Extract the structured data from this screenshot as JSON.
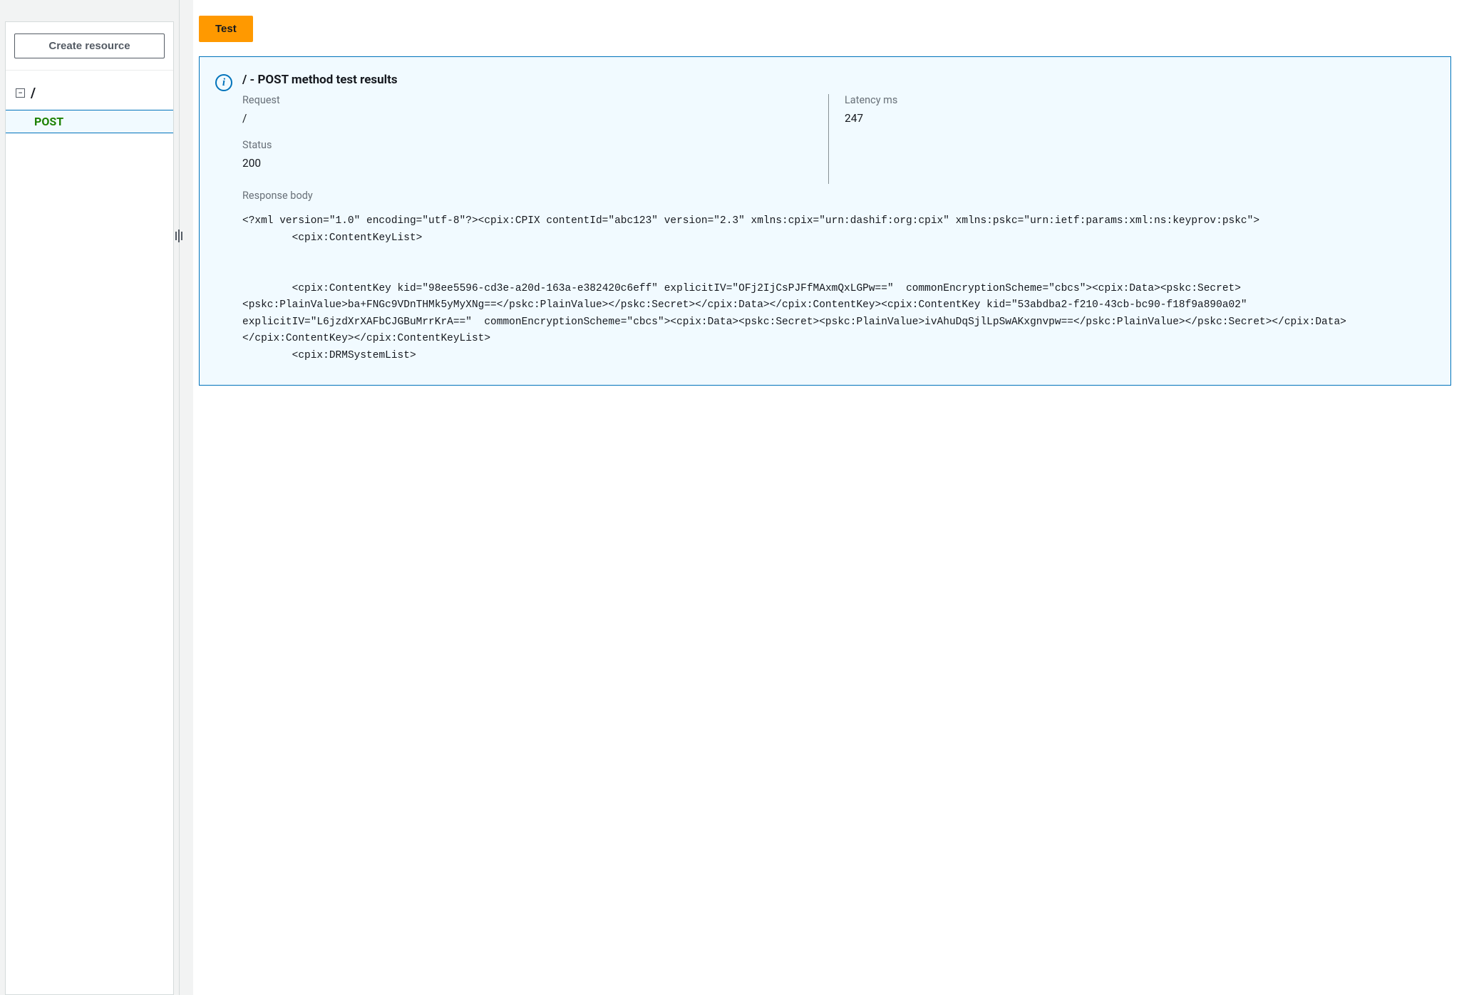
{
  "sidebar": {
    "create_resource_label": "Create resource",
    "root_label": "/",
    "method_label": "POST"
  },
  "toolbar": {
    "test_label": "Test"
  },
  "results": {
    "title": "/ - POST method test results",
    "request_label": "Request",
    "request_value": "/",
    "latency_label": "Latency ms",
    "latency_value": "247",
    "status_label": "Status",
    "status_value": "200",
    "response_body_label": "Response body",
    "response_body_value": "<?xml version=\"1.0\" encoding=\"utf-8\"?><cpix:CPIX contentId=\"abc123\" version=\"2.3\" xmlns:cpix=\"urn:dashif:org:cpix\" xmlns:pskc=\"urn:ietf:params:xml:ns:keyprov:pskc\">\n        <cpix:ContentKeyList>\n        \n        \n        <cpix:ContentKey kid=\"98ee5596-cd3e-a20d-163a-e382420c6eff\" explicitIV=\"OFj2IjCsPJFfMAxmQxLGPw==\"  commonEncryptionScheme=\"cbcs\"><cpix:Data><pskc:Secret><pskc:PlainValue>ba+FNGc9VDnTHMk5yMyXNg==</pskc:PlainValue></pskc:Secret></cpix:Data></cpix:ContentKey><cpix:ContentKey kid=\"53abdba2-f210-43cb-bc90-f18f9a890a02\" explicitIV=\"L6jzdXrXAFbCJGBuMrrKrA==\"  commonEncryptionScheme=\"cbcs\"><cpix:Data><pskc:Secret><pskc:PlainValue>ivAhuDqSjlLpSwAKxgnvpw==</pskc:PlainValue></pskc:Secret></cpix:Data></cpix:ContentKey></cpix:ContentKeyList>\n        <cpix:DRMSystemList>"
  },
  "icons": {
    "info_letter": "i",
    "minus": "−"
  }
}
